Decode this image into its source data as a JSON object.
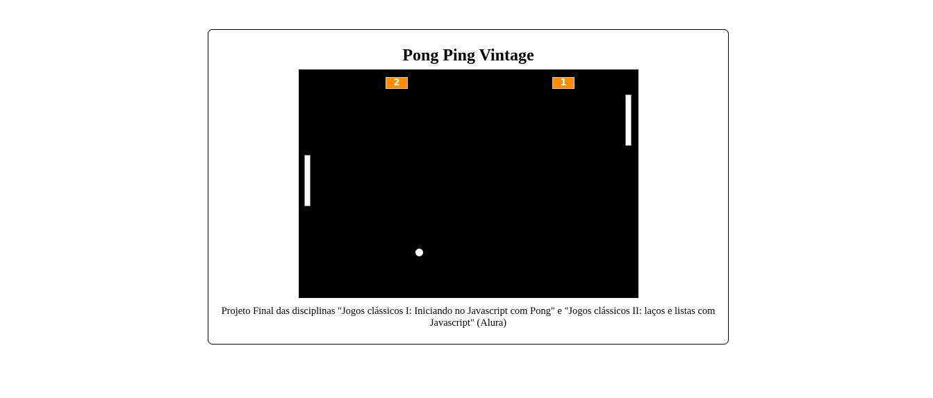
{
  "page": {
    "title": "Pong Ping Vintage",
    "footer_text": "Projeto Final das disciplinas \"Jogos clássicos I: Iniciando no Javascript com Pong\" e \"Jogos clássicos II: laços e listas com Javascript\" (Alura)"
  },
  "game": {
    "score_left": "2",
    "score_right": "1",
    "colors": {
      "canvas": "#000000",
      "score_box": "#ff8c00",
      "paddle": "#ffffff",
      "ball": "#ffffff"
    }
  }
}
